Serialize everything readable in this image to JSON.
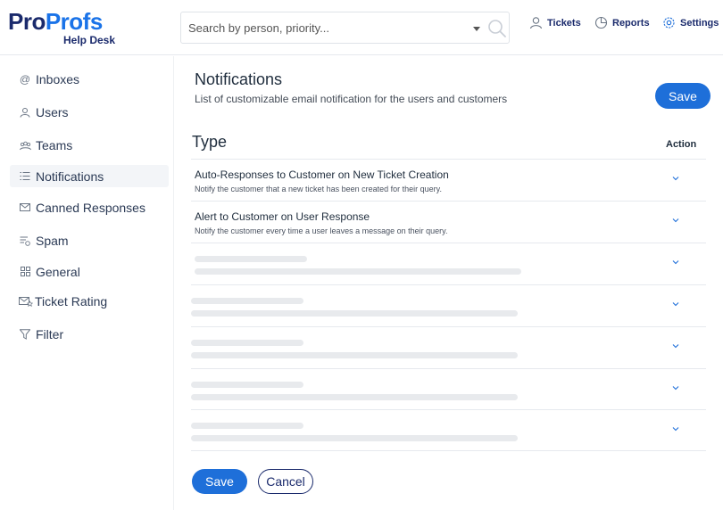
{
  "brand": {
    "name_part1": "Pro",
    "name_part2": "Profs",
    "product": "Help Desk"
  },
  "search": {
    "placeholder": "Search by person, priority..."
  },
  "topnav": {
    "tickets": "Tickets",
    "reports": "Reports",
    "settings": "Settings"
  },
  "sidebar": {
    "items": [
      {
        "label": "Inboxes",
        "icon": "at-icon"
      },
      {
        "label": "Users",
        "icon": "user-icon"
      },
      {
        "label": "Teams",
        "icon": "team-icon"
      },
      {
        "label": "Notifications",
        "icon": "list-icon",
        "active": true
      },
      {
        "label": "Canned Responses",
        "icon": "mail-icon"
      },
      {
        "label": "Spam",
        "icon": "spam-icon"
      },
      {
        "label": "General",
        "icon": "grid-icon"
      },
      {
        "label": "Ticket Rating",
        "icon": "rating-icon"
      },
      {
        "label": "Filter",
        "icon": "filter-icon"
      }
    ]
  },
  "main": {
    "title": "Notifications",
    "subtitle": "List of customizable email notification for the users and customers",
    "save_label": "Save",
    "type_header": "Type",
    "action_header": "Action",
    "rows": [
      {
        "title": "Auto-Responses to Customer on New Ticket Creation",
        "desc": "Notify the customer that a new ticket has been created for their query."
      },
      {
        "title": "Alert to Customer on User Response",
        "desc": "Notify the customer every time a user leaves a message on their query."
      }
    ],
    "loading_rows": 5,
    "footer_save": "Save",
    "footer_cancel": "Cancel"
  },
  "colors": {
    "primary": "#1e6fd9",
    "brand_dark": "#1a2a6c",
    "skeleton": "#e8eaed"
  }
}
